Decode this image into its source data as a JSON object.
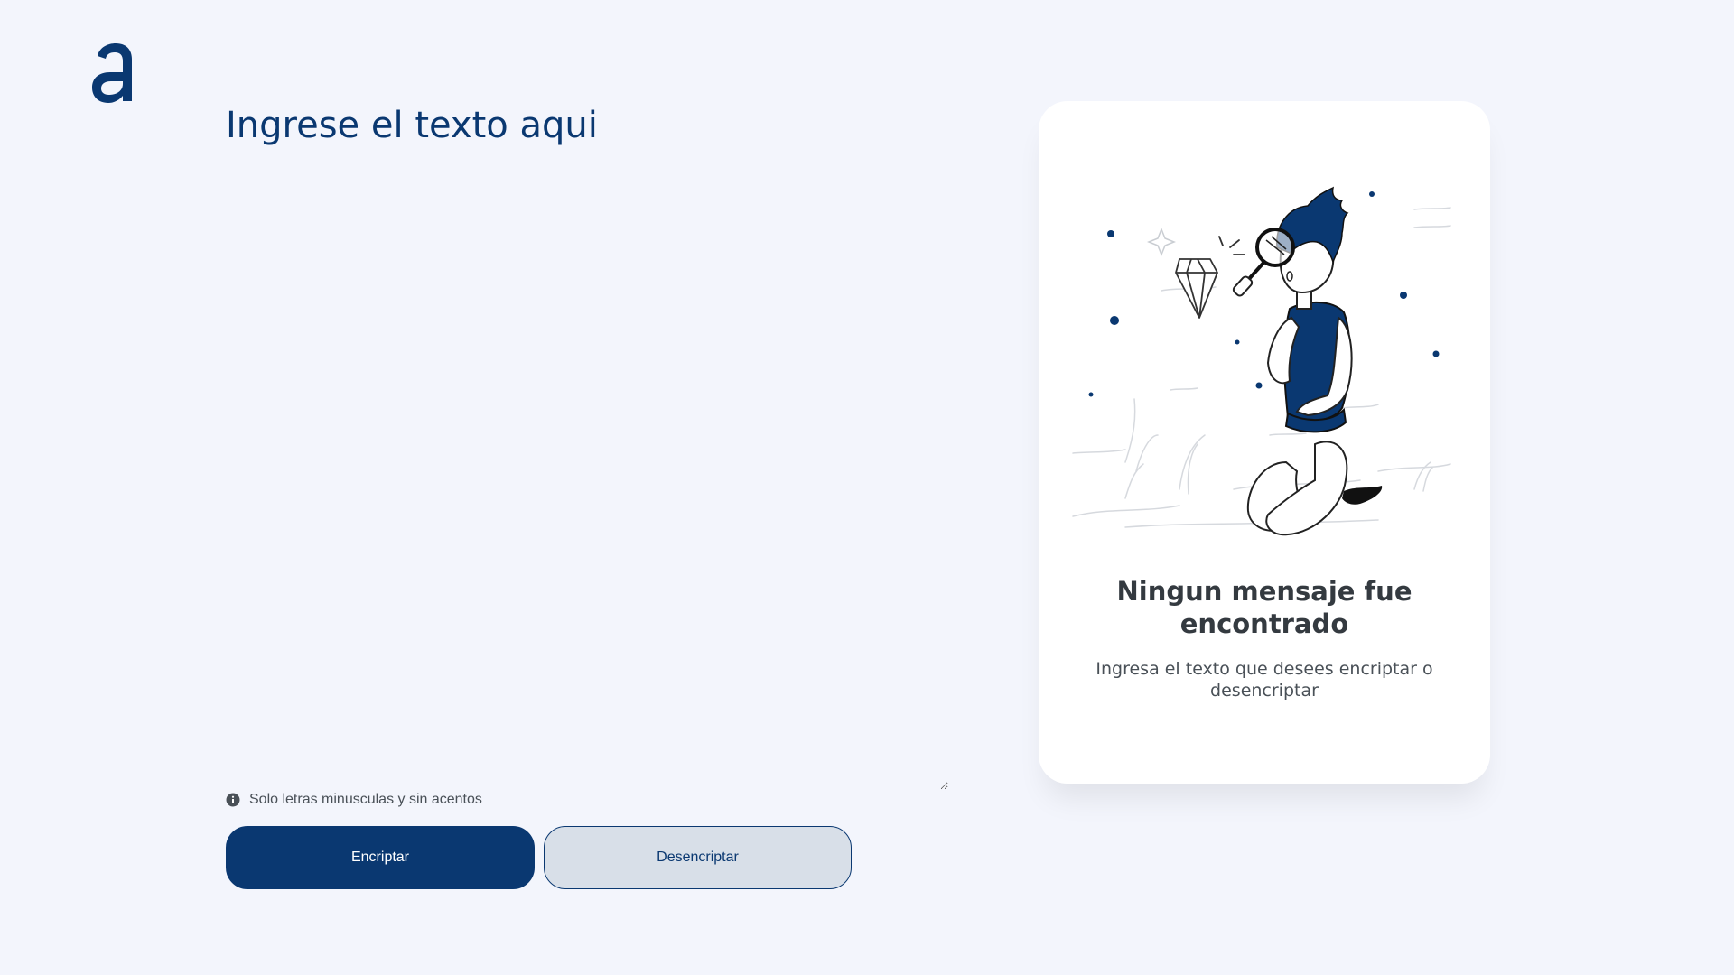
{
  "logo": {
    "icon": "alura-a-logo-icon",
    "color": "#0A3871"
  },
  "input": {
    "placeholder": "Ingrese el texto aqui",
    "value": ""
  },
  "hint": {
    "icon": "info-circle-icon",
    "text": "Solo letras minusculas y sin acentos"
  },
  "buttons": {
    "encrypt_label": "Encriptar",
    "decrypt_label": "Desencriptar"
  },
  "output_panel": {
    "illustration": "person-with-magnifying-glass-and-diamond-illustration",
    "title": "Ningun mensaje fue encontrado",
    "message": "Ingresa el texto que desees encriptar o desencriptar"
  },
  "colors": {
    "background": "#F3F5FC",
    "primary": "#0A3871",
    "secondary_button": "#D8DFE8",
    "card": "#FFFFFF",
    "title_text": "#343A40",
    "body_text": "#495057"
  }
}
